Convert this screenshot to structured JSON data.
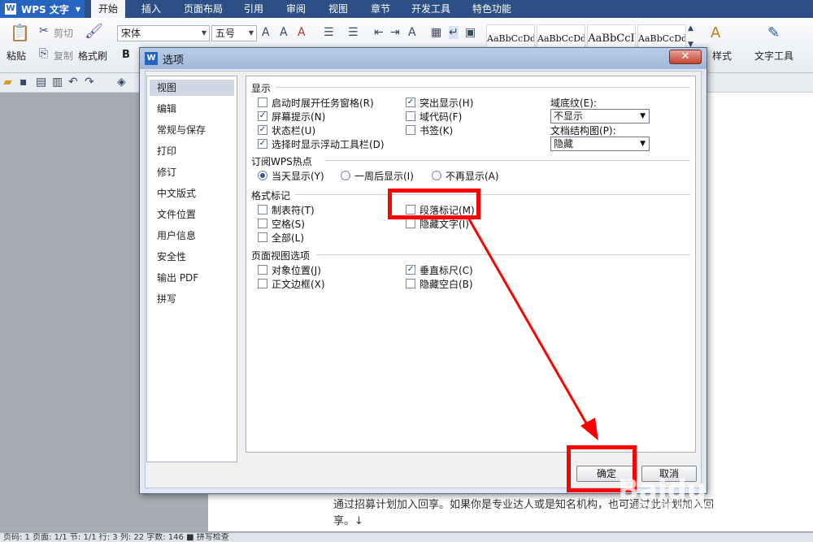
{
  "app": {
    "title": "WPS 文字"
  },
  "menu": [
    "开始",
    "插入",
    "页面布局",
    "引用",
    "审阅",
    "视图",
    "章节",
    "开发工具",
    "特色功能"
  ],
  "ribbon": {
    "paste": "粘贴",
    "cut": "剪切",
    "copy": "复制",
    "format_painter": "格式刷",
    "bold": "B",
    "font_name": "宋体",
    "font_size": "五号",
    "style_samples": [
      "AaBbCcDd",
      "AaBbCcDd",
      "AaBbCcI",
      "AaBbCcDd"
    ],
    "styles_label": "样式",
    "text_tools": "文字工具"
  },
  "dialog": {
    "title": "选项",
    "close": "✕",
    "nav": [
      "视图",
      "编辑",
      "常规与保存",
      "打印",
      "修订",
      "中文版式",
      "文件位置",
      "用户信息",
      "安全性",
      "输出 PDF",
      "拼写"
    ],
    "sections": {
      "display": "显示",
      "hotspot": "订阅WPS热点",
      "format_marks": "格式标记",
      "page_view": "页面视图选项"
    },
    "display_options": [
      {
        "label": "启动时展开任务窗格(R)",
        "checked": false
      },
      {
        "label": "屏幕提示(N)",
        "checked": true
      },
      {
        "label": "状态栏(U)",
        "checked": true
      },
      {
        "label": "选择时显示浮动工具栏(D)",
        "checked": true
      },
      {
        "label": "突出显示(H)",
        "checked": true
      },
      {
        "label": "域代码(F)",
        "checked": false
      },
      {
        "label": "书签(K)",
        "checked": false
      }
    ],
    "field_shading": {
      "label": "域底纹(E):",
      "value": "不显示"
    },
    "doc_map": {
      "label": "文档结构图(P):",
      "value": "隐藏"
    },
    "hotspot_options": [
      {
        "label": "当天显示(Y)",
        "selected": true
      },
      {
        "label": "一周后显示(I)",
        "selected": false
      },
      {
        "label": "不再显示(A)",
        "selected": false
      }
    ],
    "format_marks": [
      {
        "label": "制表符(T)",
        "checked": false
      },
      {
        "label": "空格(S)",
        "checked": false
      },
      {
        "label": "全部(L)",
        "checked": false
      },
      {
        "label": "段落标记(M)",
        "checked": false
      },
      {
        "label": "隐藏文字(I)",
        "checked": false
      }
    ],
    "page_view_options": [
      {
        "label": "对象位置(J)",
        "checked": false
      },
      {
        "label": "正文边框(X)",
        "checked": false
      },
      {
        "label": "垂直标尺(C)",
        "checked": true
      },
      {
        "label": "隐藏空白(B)",
        "checked": false
      }
    ],
    "ok": "确定",
    "cancel": "取消"
  },
  "document": {
    "text": "通过招募计划加入回享。如果你是专业达人或是知名机构，也可通过此计划加入回享。↓"
  },
  "statusbar": {
    "text": "页码: 1   页面: 1/1   节: 1/1   行: 3   列: 22   字数: 146   ■ 拼写检查"
  },
  "watermark": {
    "text": "Baidu 经验",
    "sub": "jingyan.baidu.com"
  }
}
